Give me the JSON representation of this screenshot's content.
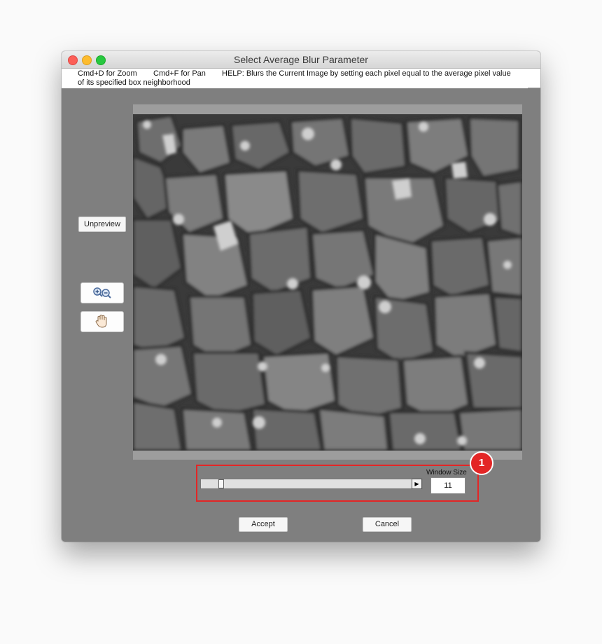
{
  "window": {
    "title": "Select Average Blur Parameter"
  },
  "help": {
    "zoom_hint": "Cmd+D for Zoom",
    "pan_hint": "Cmd+F for Pan",
    "help_line1": "HELP:  Blurs the Current Image by setting each pixel equal to the average pixel value",
    "help_line2": "of its specified box neighborhood"
  },
  "buttons": {
    "unpreview": "Unpreview",
    "accept": "Accept",
    "cancel": "Cancel"
  },
  "icons": {
    "zoom": "zoom-in-out-icon",
    "pan": "hand-icon"
  },
  "slider": {
    "label": "Window Size",
    "value": "11",
    "position_fraction": 0.04
  },
  "callout": {
    "number": "1"
  },
  "colors": {
    "panel": "#7f7f7f",
    "highlight": "#e32626"
  }
}
